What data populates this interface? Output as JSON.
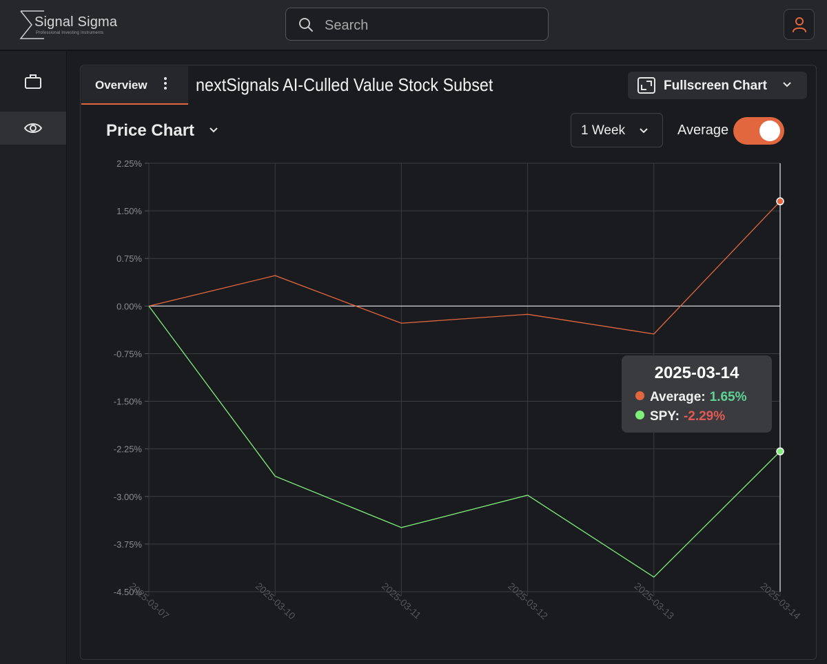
{
  "app": {
    "brand_name": "Signal Sigma",
    "brand_tagline": "Professional Investing Instruments"
  },
  "search": {
    "placeholder": "Search"
  },
  "tabs": {
    "overview_label": "Overview"
  },
  "page_title": "nextSignals AI-Culled Value Stock Subset",
  "fullscreen_label": "Fullscreen Chart",
  "section_title": "Price Chart",
  "range_label": "1 Week",
  "average_toggle": {
    "label": "Average",
    "on": true
  },
  "colors": {
    "accent": "#e2673f",
    "average_line": "#e2673f",
    "spy_line": "#7ef07a",
    "positive_text": "#5fd394",
    "negative_text": "#e05a55"
  },
  "icons": {
    "logo": "sigma-logo-icon",
    "search": "search-icon",
    "user": "user-icon",
    "sidebar_portfolio": "briefcase-icon",
    "sidebar_watch": "eye-icon",
    "fullscreen": "fullscreen-icon"
  },
  "tooltip": {
    "date": "2025-03-14",
    "rows": [
      {
        "name": "Average:",
        "value": "1.65%"
      },
      {
        "name": "SPY:",
        "value": "-2.29%"
      }
    ]
  },
  "chart_data": {
    "type": "line",
    "x": [
      "2025-03-07",
      "2025-03-10",
      "2025-03-11",
      "2025-03-12",
      "2025-03-13",
      "2025-03-14"
    ],
    "y_ticks": [
      "2.25%",
      "1.50%",
      "0.75%",
      "0.00%",
      "-0.75%",
      "-1.50%",
      "-2.25%",
      "-3.00%",
      "-3.75%",
      "-4.50%"
    ],
    "ylim": [
      -4.5,
      2.25
    ],
    "y_unit": "%",
    "grid": true,
    "series": [
      {
        "name": "Average",
        "values": [
          0.0,
          0.48,
          -0.27,
          -0.13,
          -0.44,
          1.65
        ]
      },
      {
        "name": "SPY",
        "values": [
          0.0,
          -2.68,
          -3.49,
          -2.98,
          -4.27,
          -2.29
        ]
      }
    ]
  }
}
